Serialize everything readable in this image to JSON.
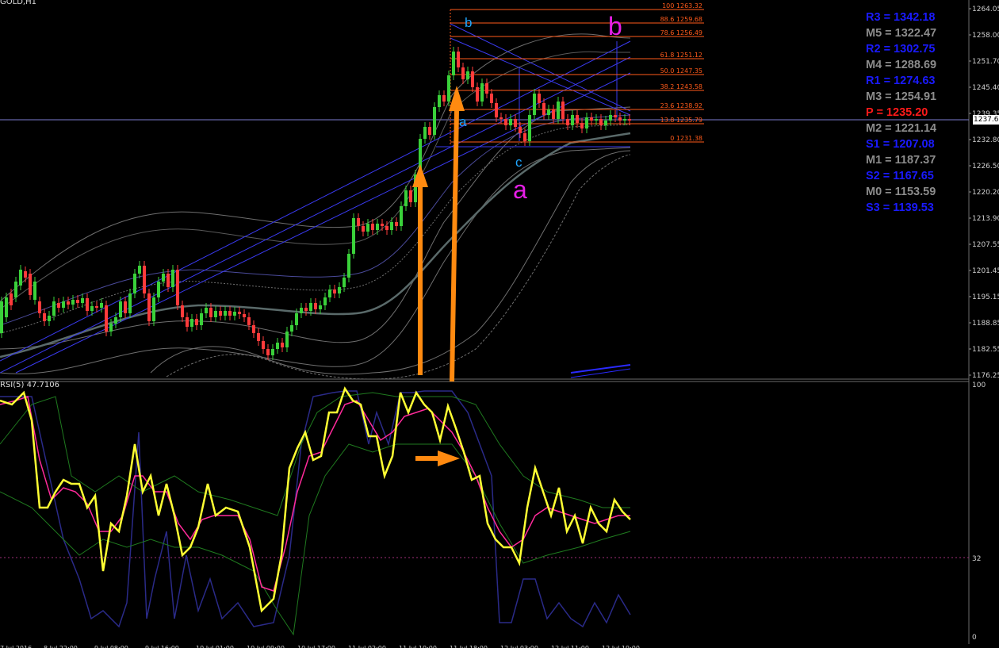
{
  "window": {
    "title": "GOLD,H1"
  },
  "rsi": {
    "title": "RSI(5) 47.7106",
    "levels": [
      "100",
      "32",
      "0"
    ]
  },
  "current_price_tag": "1237.61",
  "price_axis": [
    "1264.05",
    "1258.00",
    "1251.70",
    "1245.40",
    "1239.35",
    "1232.80",
    "1226.50",
    "1220.20",
    "1213.90",
    "1207.55",
    "1201.45",
    "1195.15",
    "1188.85",
    "1182.55",
    "1176.25"
  ],
  "fib_levels": [
    {
      "label": "100 1263.32"
    },
    {
      "label": "88.6 1259.68"
    },
    {
      "label": "78.6 1256.49"
    },
    {
      "label": "61.8 1251.12"
    },
    {
      "label": "50.0 1247.35"
    },
    {
      "label": "38.2 1243.58"
    },
    {
      "label": "23.6 1238.92"
    },
    {
      "label": "13.8 1235.79"
    },
    {
      "label": "0 1231.38"
    }
  ],
  "wave_labels": {
    "b_small": "b",
    "a_small": "a",
    "c_small": "c",
    "a_big": "a",
    "b_big": "b"
  },
  "pivots": [
    {
      "label": "R3 = 1342.18",
      "color": "#1a1aff"
    },
    {
      "label": "M5 = 1322.47",
      "color": "#8c8c8c"
    },
    {
      "label": "R2 = 1302.75",
      "color": "#1a1aff"
    },
    {
      "label": "M4 = 1288.69",
      "color": "#8c8c8c"
    },
    {
      "label": "R1 = 1274.63",
      "color": "#1a1aff"
    },
    {
      "label": "M3 = 1254.91",
      "color": "#8c8c8c"
    },
    {
      "label": "P  = 1235.20",
      "color": "#ff1a1a"
    },
    {
      "label": "M2 = 1221.14",
      "color": "#8c8c8c"
    },
    {
      "label": "S1 = 1207.08",
      "color": "#1a1aff"
    },
    {
      "label": "M1 = 1187.37",
      "color": "#8c8c8c"
    },
    {
      "label": "S2 = 1167.65",
      "color": "#1a1aff"
    },
    {
      "label": "M0 = 1153.59",
      "color": "#8c8c8c"
    },
    {
      "label": "S3 = 1139.53",
      "color": "#1a1aff"
    }
  ],
  "time_axis": [
    "7 Jul 2016",
    "8 Jul 22:00",
    "9 Jul 08:00",
    "9 Jul 16:00",
    "10 Jul 01:00",
    "10 Jul 09:00",
    "10 Jul 17:00",
    "11 Jul 02:00",
    "11 Jul 10:00",
    "11 Jul 18:00",
    "12 Jul 03:00",
    "12 Jul 11:00",
    "12 Jul 19:00"
  ],
  "colors": {
    "bull": "#3ad13a",
    "bear": "#ff3b3b",
    "rsi": "#ffff33",
    "signal": "#ff2a9a",
    "arrow": "#ff8a10",
    "fib": "#ff5a1a",
    "wave_small": "#1fa6ff",
    "wave_big": "#e61ee6"
  }
}
